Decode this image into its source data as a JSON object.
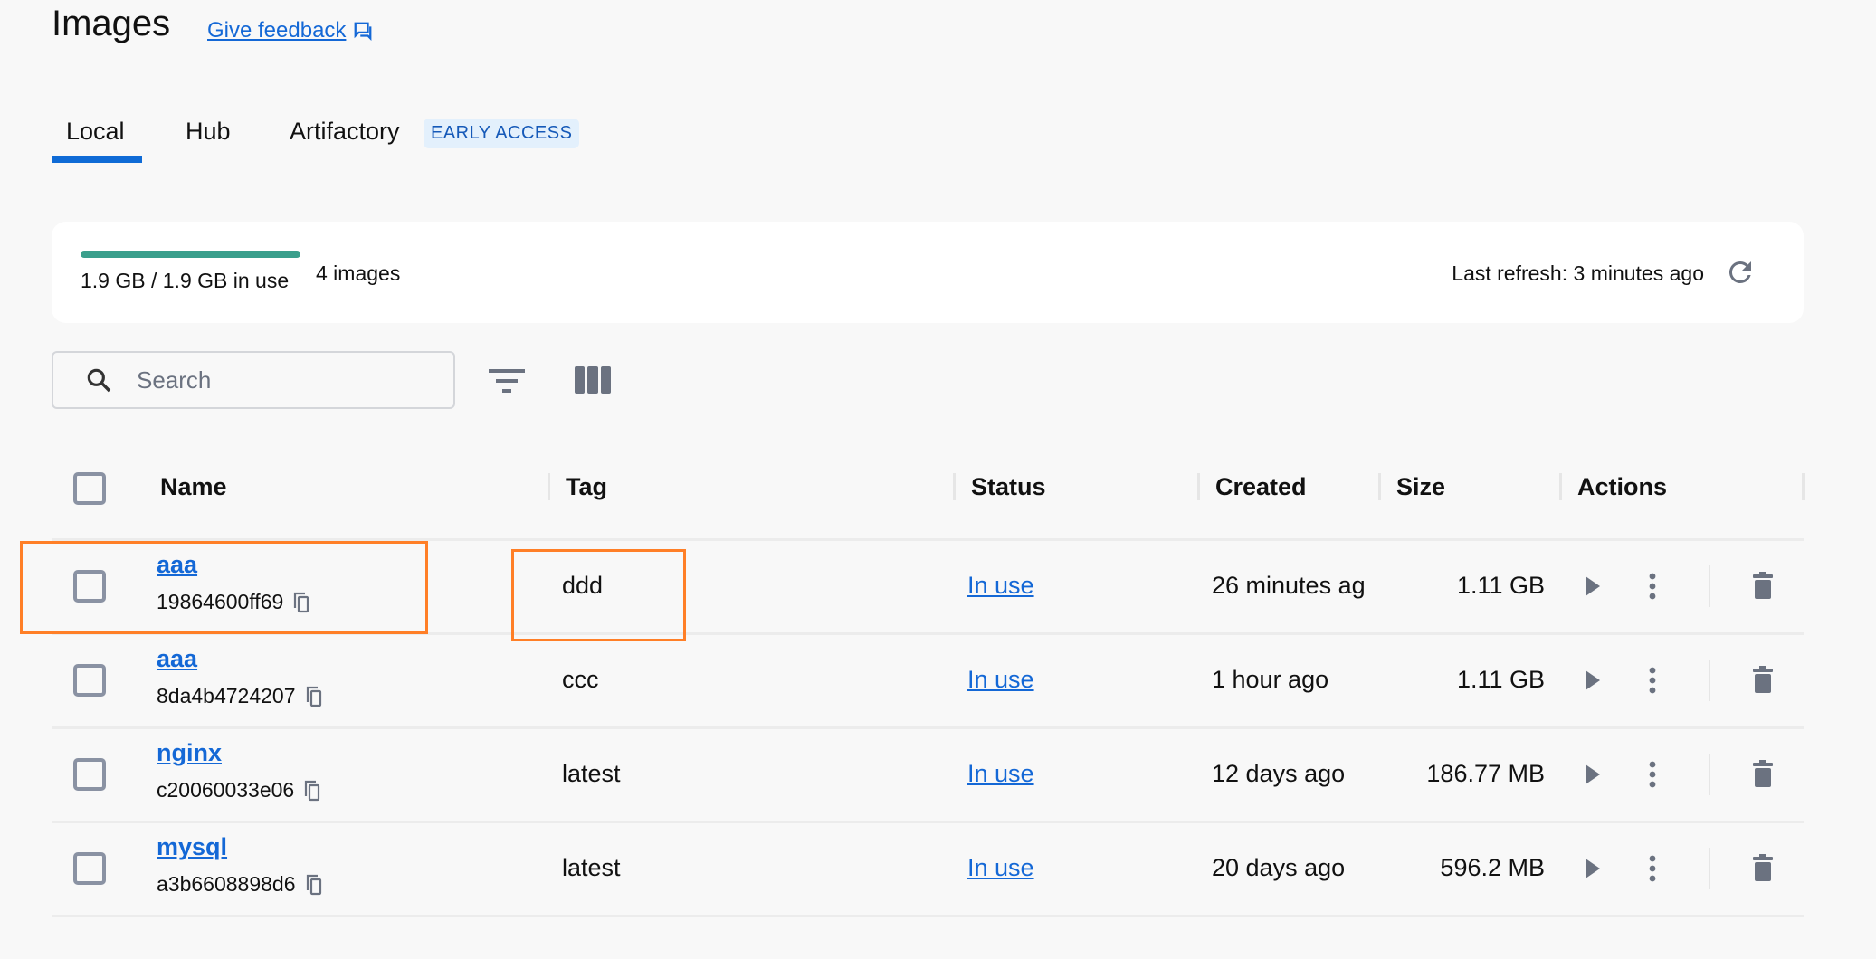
{
  "header": {
    "title": "Images",
    "feedback": "Give feedback"
  },
  "tabs": [
    {
      "label": "Local",
      "active": true
    },
    {
      "label": "Hub"
    },
    {
      "label": "Artifactory",
      "badge": "EARLY ACCESS"
    }
  ],
  "summary": {
    "usage": "1.9 GB / 1.9 GB in use",
    "usage_fraction": 1.0,
    "count": "4 images",
    "last_refresh": "Last refresh: 3 minutes ago"
  },
  "search": {
    "placeholder": "Search"
  },
  "table": {
    "columns": [
      "Name",
      "Tag",
      "Status",
      "Created",
      "Size",
      "Actions"
    ],
    "rows": [
      {
        "name": "aaa",
        "id": "19864600ff69",
        "tag": "ddd",
        "status": "In use",
        "created": "26 minutes ag",
        "size": "1.11 GB"
      },
      {
        "name": "aaa",
        "id": "8da4b4724207",
        "tag": "ccc",
        "status": "In use",
        "created": "1 hour ago",
        "size": "1.11 GB"
      },
      {
        "name": "nginx",
        "id": "c20060033e06",
        "tag": "latest",
        "status": "In use",
        "created": "12 days ago",
        "size": "186.77 MB"
      },
      {
        "name": "mysql",
        "id": "a3b6608898d6",
        "tag": "latest",
        "status": "In use",
        "created": "20 days ago",
        "size": "596.2 MB"
      }
    ]
  },
  "colors": {
    "accent": "#1468d6",
    "progress": "#3a9f8c",
    "highlight": "#ff7f27"
  }
}
